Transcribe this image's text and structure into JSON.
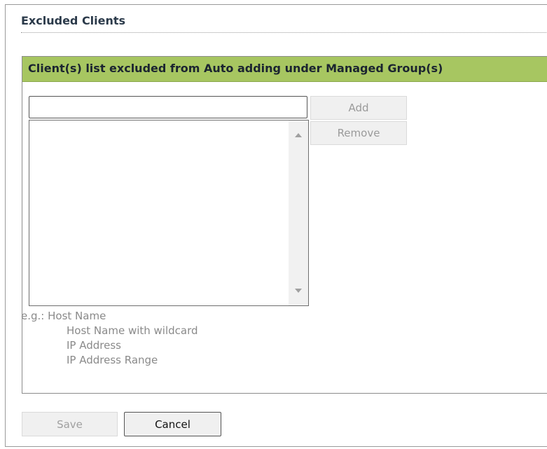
{
  "page": {
    "title": "Excluded Clients"
  },
  "panel": {
    "header": "Client(s) list excluded from Auto adding under Managed Group(s)",
    "input_value": "",
    "add_label": "Add",
    "remove_label": "Remove",
    "list_items": [],
    "hint_prefix": "e.g.:",
    "hints": [
      "Host Name",
      "Host Name with wildcard",
      "IP Address",
      "IP Address Range"
    ]
  },
  "footer": {
    "save_label": "Save",
    "cancel_label": "Cancel"
  },
  "colors": {
    "header_bg": "#a7c661",
    "disabled_text": "#9a9a9a"
  }
}
